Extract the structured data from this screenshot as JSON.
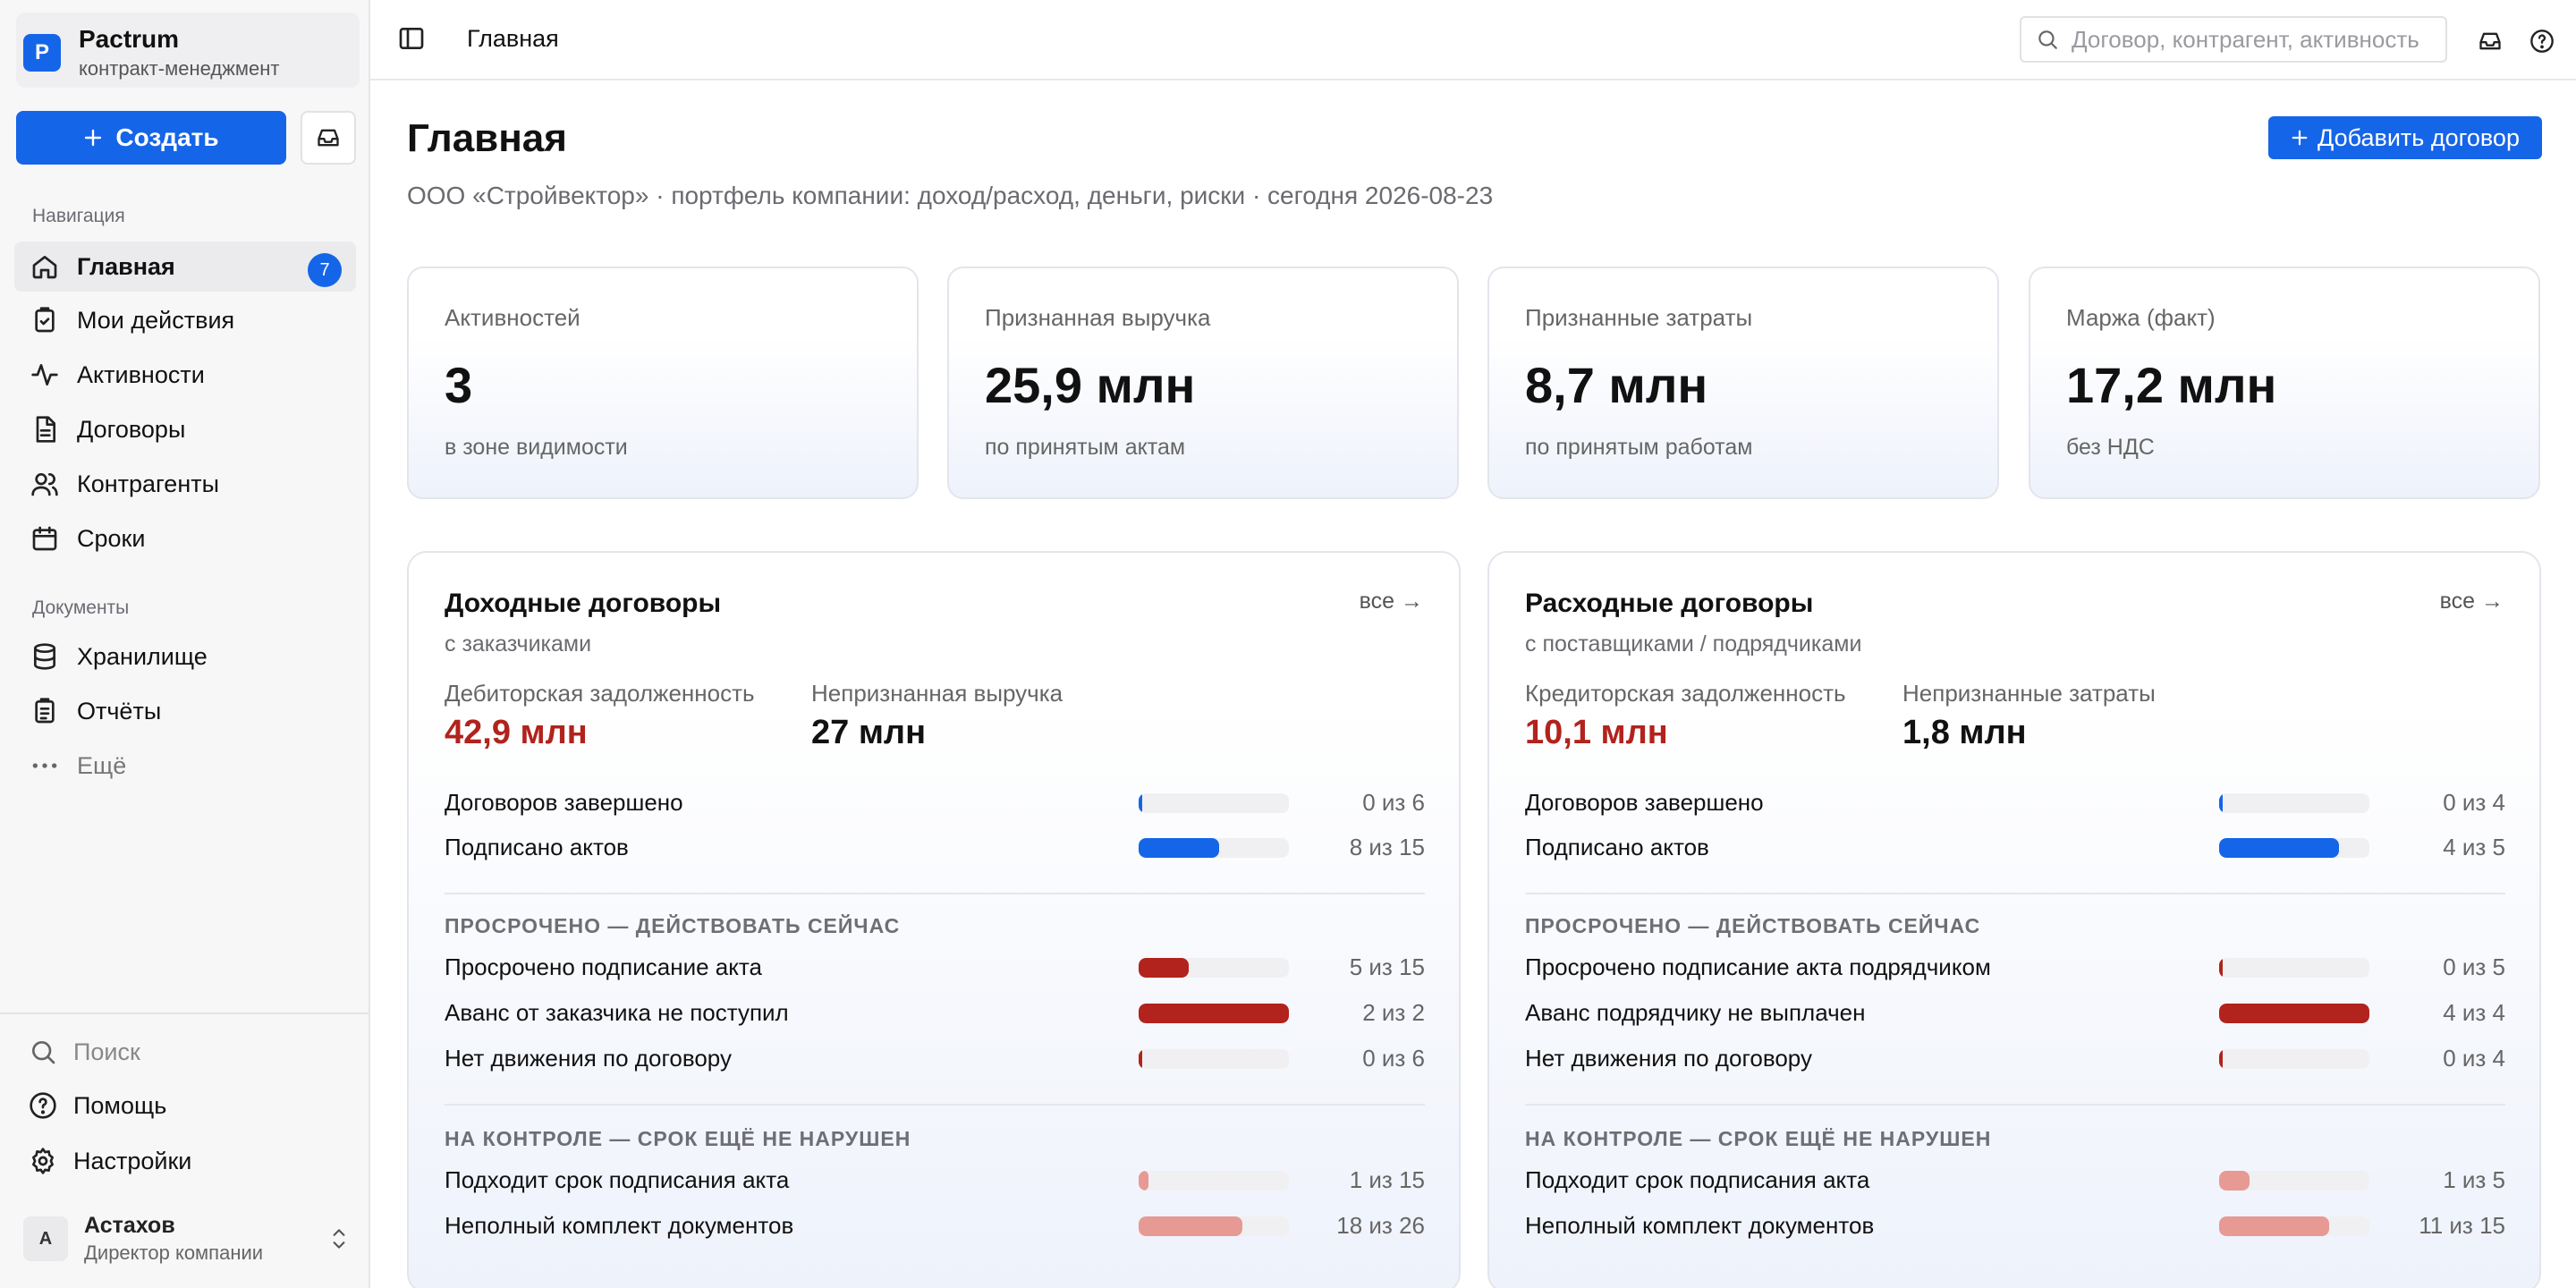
{
  "org": {
    "logo_letter": "P",
    "name": "Pactrum",
    "subtitle": "контракт-менеджмент"
  },
  "sidebar": {
    "create_label": "Создать",
    "section_nav": "Навигация",
    "nav": [
      {
        "label": "Главная",
        "badge": "7",
        "active": true
      },
      {
        "label": "Мои действия"
      },
      {
        "label": "Активности"
      },
      {
        "label": "Договоры"
      },
      {
        "label": "Контрагенты"
      },
      {
        "label": "Сроки"
      }
    ],
    "section_docs": "Документы",
    "docs": [
      {
        "label": "Хранилище"
      },
      {
        "label": "Отчёты"
      },
      {
        "label": "Ещё"
      }
    ],
    "footer": [
      {
        "label": "Поиск"
      },
      {
        "label": "Помощь"
      },
      {
        "label": "Настройки"
      }
    ],
    "user": {
      "initial": "А",
      "name": "Астахов",
      "role": "Директор компании"
    }
  },
  "topbar": {
    "title": "Главная",
    "search_placeholder": "Договор, контрагент, активность"
  },
  "main": {
    "title": "Главная",
    "subtitle": "ООО «Стройвектор» · портфель компании: доход/расход, деньги, риски · сегодня 2026-08-23",
    "add_label": "Добавить договор",
    "kpis": [
      {
        "label": "Активностей",
        "value": "3",
        "note": "в зоне видимости"
      },
      {
        "label": "Признанная выручка",
        "value": "25,9 млн",
        "note": "по принятым актам"
      },
      {
        "label": "Признанные затраты",
        "value": "8,7 млн",
        "note": "по принятым работам"
      },
      {
        "label": "Маржа (факт)",
        "value": "17,2 млн",
        "note": "без НДС"
      }
    ],
    "panels": [
      {
        "title": "Доходные договоры",
        "subtitle": "с заказчиками",
        "all_link": "все →",
        "stat1_label": "Дебиторская задолженность",
        "stat1_value": "42,9 млн",
        "stat2_label": "Непризнанная выручка",
        "stat2_value": "27 млн",
        "progress": [
          {
            "label": "Договоров завершено",
            "value": "0 из 6",
            "fraction": 0
          },
          {
            "label": "Подписано актов",
            "value": "8 из 15",
            "fraction": 0.533
          }
        ],
        "overdue_title": "ПРОСРОЧЕНО — ДЕЙСТВОВАТЬ СЕЙЧАС",
        "overdue": [
          {
            "label": "Просрочено подписание акта",
            "value": "5 из 15",
            "fraction": 0.333
          },
          {
            "label": "Аванс от заказчика не поступил",
            "value": "2 из 2",
            "fraction": 1
          },
          {
            "label": "Нет движения по договору",
            "value": "0 из 6",
            "fraction": 0
          }
        ],
        "control_title": "НА КОНТРОЛЕ — СРОК ЕЩЁ НЕ НАРУШЕН",
        "control": [
          {
            "label": "Подходит срок подписания акта",
            "value": "1 из 15",
            "fraction": 0.067
          },
          {
            "label": "Неполный комплект документов",
            "value": "18 из 26",
            "fraction": 0.692
          }
        ]
      },
      {
        "title": "Расходные договоры",
        "subtitle": "с поставщиками / подрядчиками",
        "all_link": "все →",
        "stat1_label": "Кредиторская задолженность",
        "stat1_value": "10,1 млн",
        "stat2_label": "Непризнанные затраты",
        "stat2_value": "1,8 млн",
        "progress": [
          {
            "label": "Договоров завершено",
            "value": "0 из 4",
            "fraction": 0
          },
          {
            "label": "Подписано актов",
            "value": "4 из 5",
            "fraction": 0.8
          }
        ],
        "overdue_title": "ПРОСРОЧЕНО — ДЕЙСТВОВАТЬ СЕЙЧАС",
        "overdue": [
          {
            "label": "Просрочено подписание акта подрядчиком",
            "value": "0 из 5",
            "fraction": 0
          },
          {
            "label": "Аванс подрядчику не выплачен",
            "value": "4 из 4",
            "fraction": 1
          },
          {
            "label": "Нет движения по договору",
            "value": "0 из 4",
            "fraction": 0
          }
        ],
        "control_title": "НА КОНТРОЛЕ — СРОК ЕЩЁ НЕ НАРУШЕН",
        "control": [
          {
            "label": "Подходит срок подписания акта",
            "value": "1 из 5",
            "fraction": 0.2
          },
          {
            "label": "Неполный комплект документов",
            "value": "11 из 15",
            "fraction": 0.733
          }
        ]
      }
    ]
  },
  "colors": {
    "accent": "#1565e8",
    "danger": "#b1231c",
    "warning": "#e69a93"
  }
}
